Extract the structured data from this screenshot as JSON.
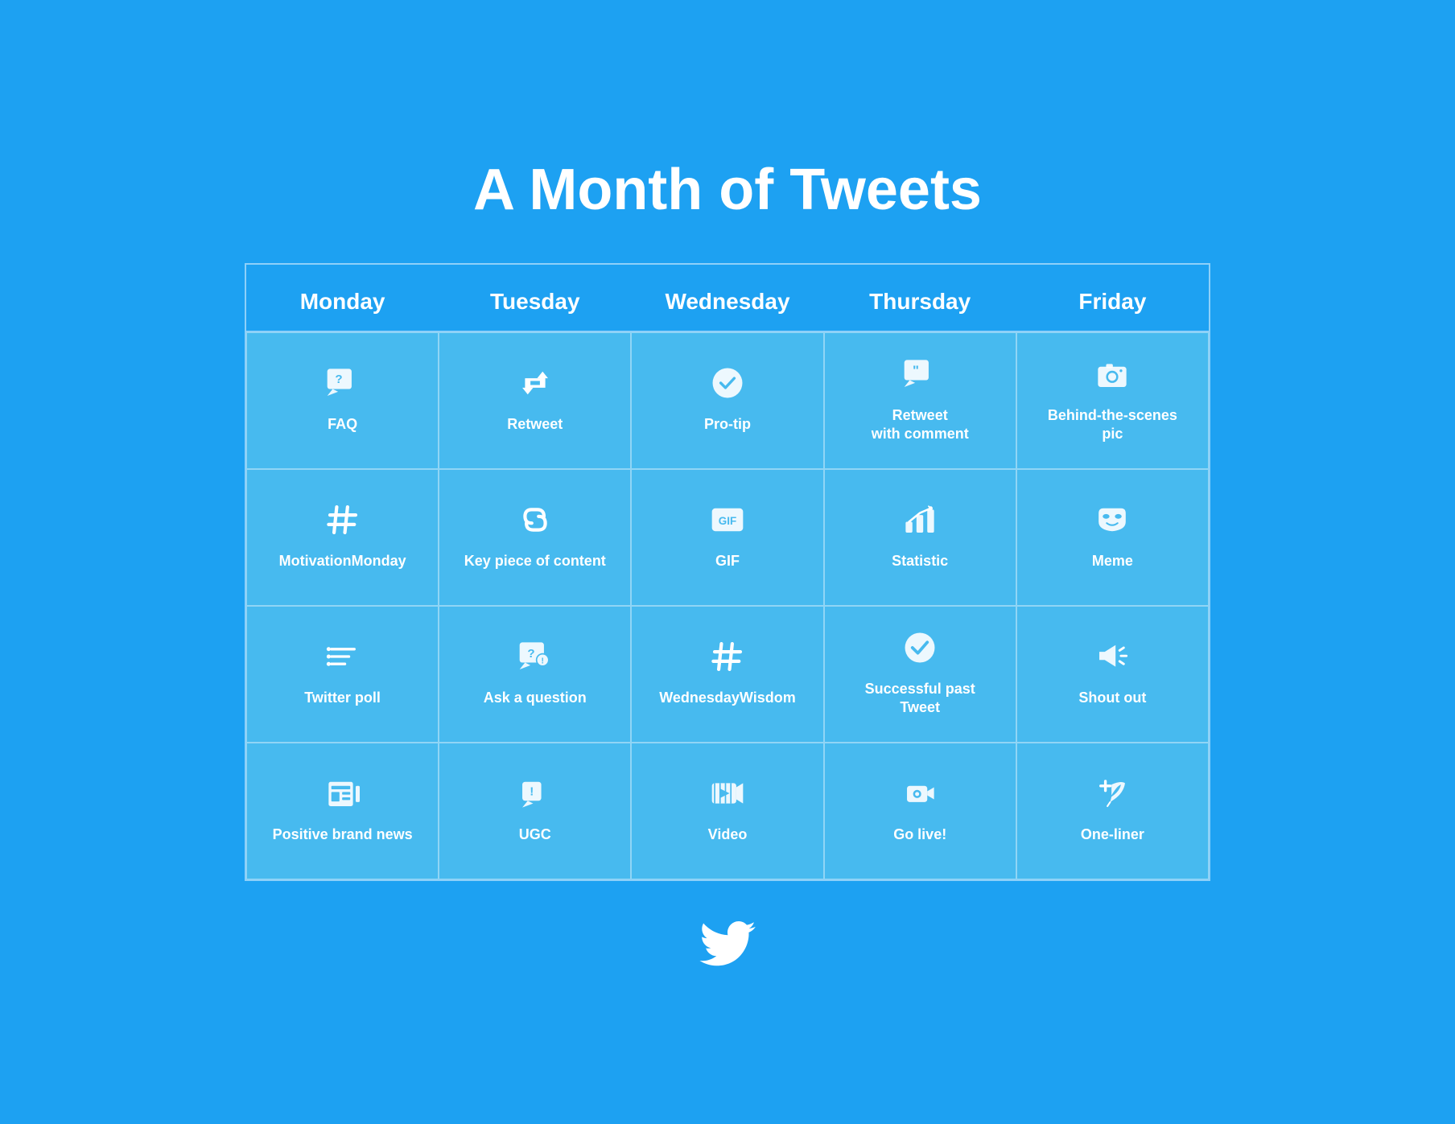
{
  "page": {
    "title": "A Month of Tweets",
    "background_color": "#1DA1F2",
    "cell_color": "#47BAEF"
  },
  "headers": [
    {
      "id": "monday",
      "label": "Monday"
    },
    {
      "id": "tuesday",
      "label": "Tuesday"
    },
    {
      "id": "wednesday",
      "label": "Wednesday"
    },
    {
      "id": "thursday",
      "label": "Thursday"
    },
    {
      "id": "friday",
      "label": "Friday"
    }
  ],
  "rows": [
    [
      {
        "id": "faq",
        "label": "FAQ",
        "icon": "faq"
      },
      {
        "id": "retweet",
        "label": "Retweet",
        "icon": "retweet"
      },
      {
        "id": "pro-tip",
        "label": "Pro-tip",
        "icon": "protip"
      },
      {
        "id": "retweet-comment",
        "label": "Retweet\nwith comment",
        "icon": "quote"
      },
      {
        "id": "behind-scenes",
        "label": "Behind-the-scenes\npic",
        "icon": "camera"
      }
    ],
    [
      {
        "id": "motivation-monday",
        "label": "MotivationMonday",
        "icon": "hashtag"
      },
      {
        "id": "key-content",
        "label": "Key piece of content",
        "icon": "link"
      },
      {
        "id": "gif",
        "label": "GIF",
        "icon": "gif"
      },
      {
        "id": "statistic",
        "label": "Statistic",
        "icon": "chart"
      },
      {
        "id": "meme",
        "label": "Meme",
        "icon": "mask"
      }
    ],
    [
      {
        "id": "twitter-poll",
        "label": "Twitter poll",
        "icon": "poll"
      },
      {
        "id": "ask-question",
        "label": "Ask a question",
        "icon": "question"
      },
      {
        "id": "wednesday-wisdom",
        "label": "WednesdayWisdom",
        "icon": "hashtag"
      },
      {
        "id": "successful-tweet",
        "label": "Successful past\nTweet",
        "icon": "checkmark"
      },
      {
        "id": "shout-out",
        "label": "Shout out",
        "icon": "megaphone"
      }
    ],
    [
      {
        "id": "positive-brand",
        "label": "Positive brand news",
        "icon": "newspaper"
      },
      {
        "id": "ugc",
        "label": "UGC",
        "icon": "ugc"
      },
      {
        "id": "video",
        "label": "Video",
        "icon": "video"
      },
      {
        "id": "go-live",
        "label": "Go live!",
        "icon": "live"
      },
      {
        "id": "one-liner",
        "label": "One-liner",
        "icon": "oneliner"
      }
    ]
  ]
}
